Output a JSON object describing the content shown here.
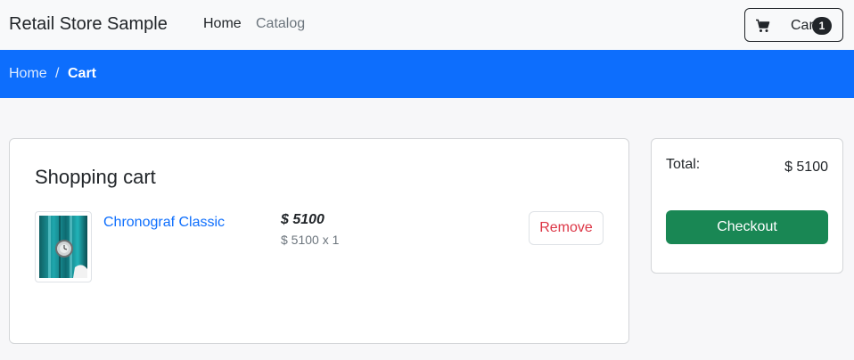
{
  "header": {
    "brand": "Retail Store Sample",
    "nav": [
      {
        "label": "Home"
      },
      {
        "label": "Catalog"
      }
    ],
    "cart": {
      "label": "Cart",
      "count": "1"
    }
  },
  "breadcrumb": {
    "home": "Home",
    "separator": "/",
    "current": "Cart"
  },
  "cart": {
    "title": "Shopping cart",
    "items": [
      {
        "name": "Chronograf Classic",
        "price": "$ 5100",
        "price_detail": "$ 5100 x 1",
        "remove_label": "Remove"
      }
    ]
  },
  "summary": {
    "total_label": "Total:",
    "total_value": "$ 5100",
    "checkout_label": "Checkout"
  },
  "colors": {
    "primary": "#0d6efd",
    "success": "#198754",
    "danger": "#dc3545"
  }
}
